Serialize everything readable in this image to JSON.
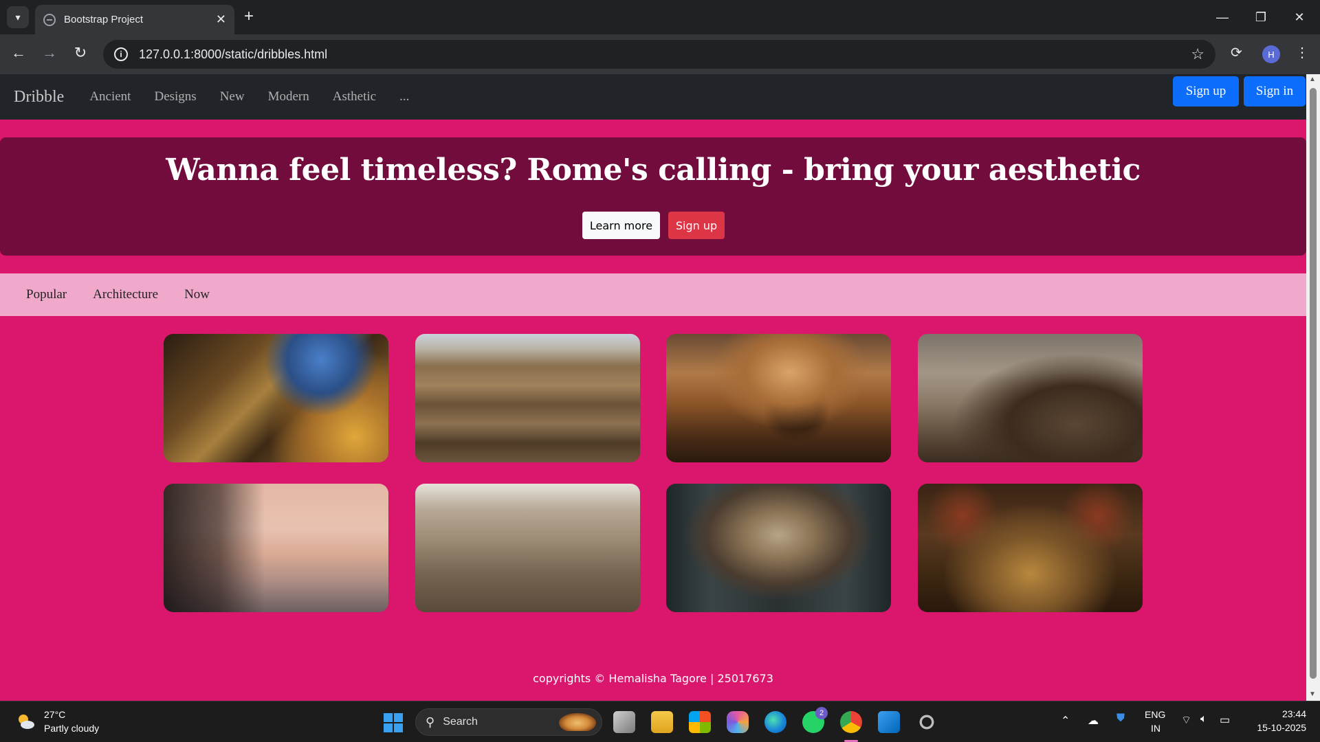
{
  "browser": {
    "tab_title": "Bootstrap Project",
    "url": "127.0.0.1:8000/static/dribbles.html",
    "profile_initial": "H"
  },
  "navbar": {
    "brand": "Dribble",
    "links": [
      "Ancient",
      "Designs",
      "New",
      "Modern",
      "Asthetic",
      "..."
    ],
    "signup": "Sign up",
    "signin": "Sign in"
  },
  "hero": {
    "headline": "Wanna feel timeless? Rome's calling - bring your aesthetic",
    "learn_more": "Learn more",
    "signup": "Sign up"
  },
  "subnav": {
    "items": [
      "Popular",
      "Architecture",
      "Now"
    ]
  },
  "gallery": {
    "images": [
      "ornate-basilica-dome-interior",
      "colosseum-interior-arena",
      "st-peters-basilica-dome-sunset",
      "colosseum-exterior-arches",
      "street-lamps-sunset-rome",
      "roman-forum-arch-ruins",
      "baroque-church-ceiling",
      "gothic-cathedral-stained-glass"
    ]
  },
  "footer": {
    "text": "copyrights © Hemalisha Tagore | 25017673"
  },
  "taskbar": {
    "temperature": "27°C",
    "weather": "Partly cloudy",
    "search": "Search",
    "language": "ENG",
    "region": "IN",
    "time": "23:44",
    "date": "15-10-2025",
    "whatsapp_badge": "2"
  },
  "colors": {
    "page_bg": "#db166d",
    "hero_bg": "#720c3d",
    "subnav_bg": "#f1a9cb",
    "primary": "#0d6efd",
    "danger": "#dc3545"
  }
}
